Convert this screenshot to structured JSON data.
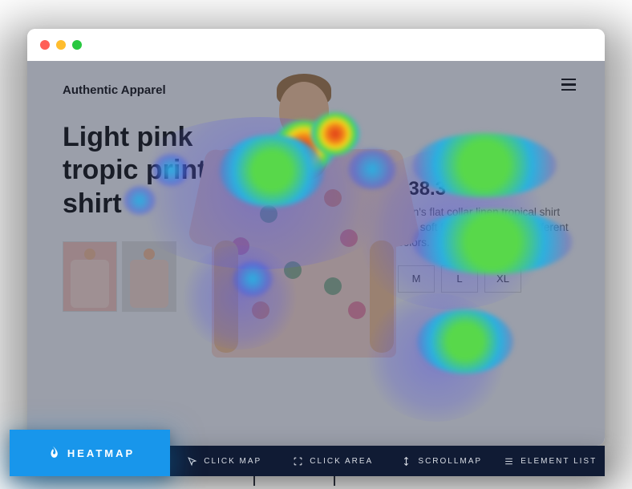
{
  "brand": "Authentic Apparel",
  "product": {
    "title": "Light pink tropic print shirt",
    "price": "$38.3",
    "description": "Men's flat collar linen tropical shirt with soft finish. Available in different colors.",
    "sizes": [
      "M",
      "L",
      "XL"
    ]
  },
  "toolbar": {
    "heatmap": "HEATMAP",
    "clickmap": "CLICK MAP",
    "clickarea": "CLICK AREA",
    "scrollmap": "SCROLLMAP",
    "elementlist": "ELEMENT LIST"
  }
}
